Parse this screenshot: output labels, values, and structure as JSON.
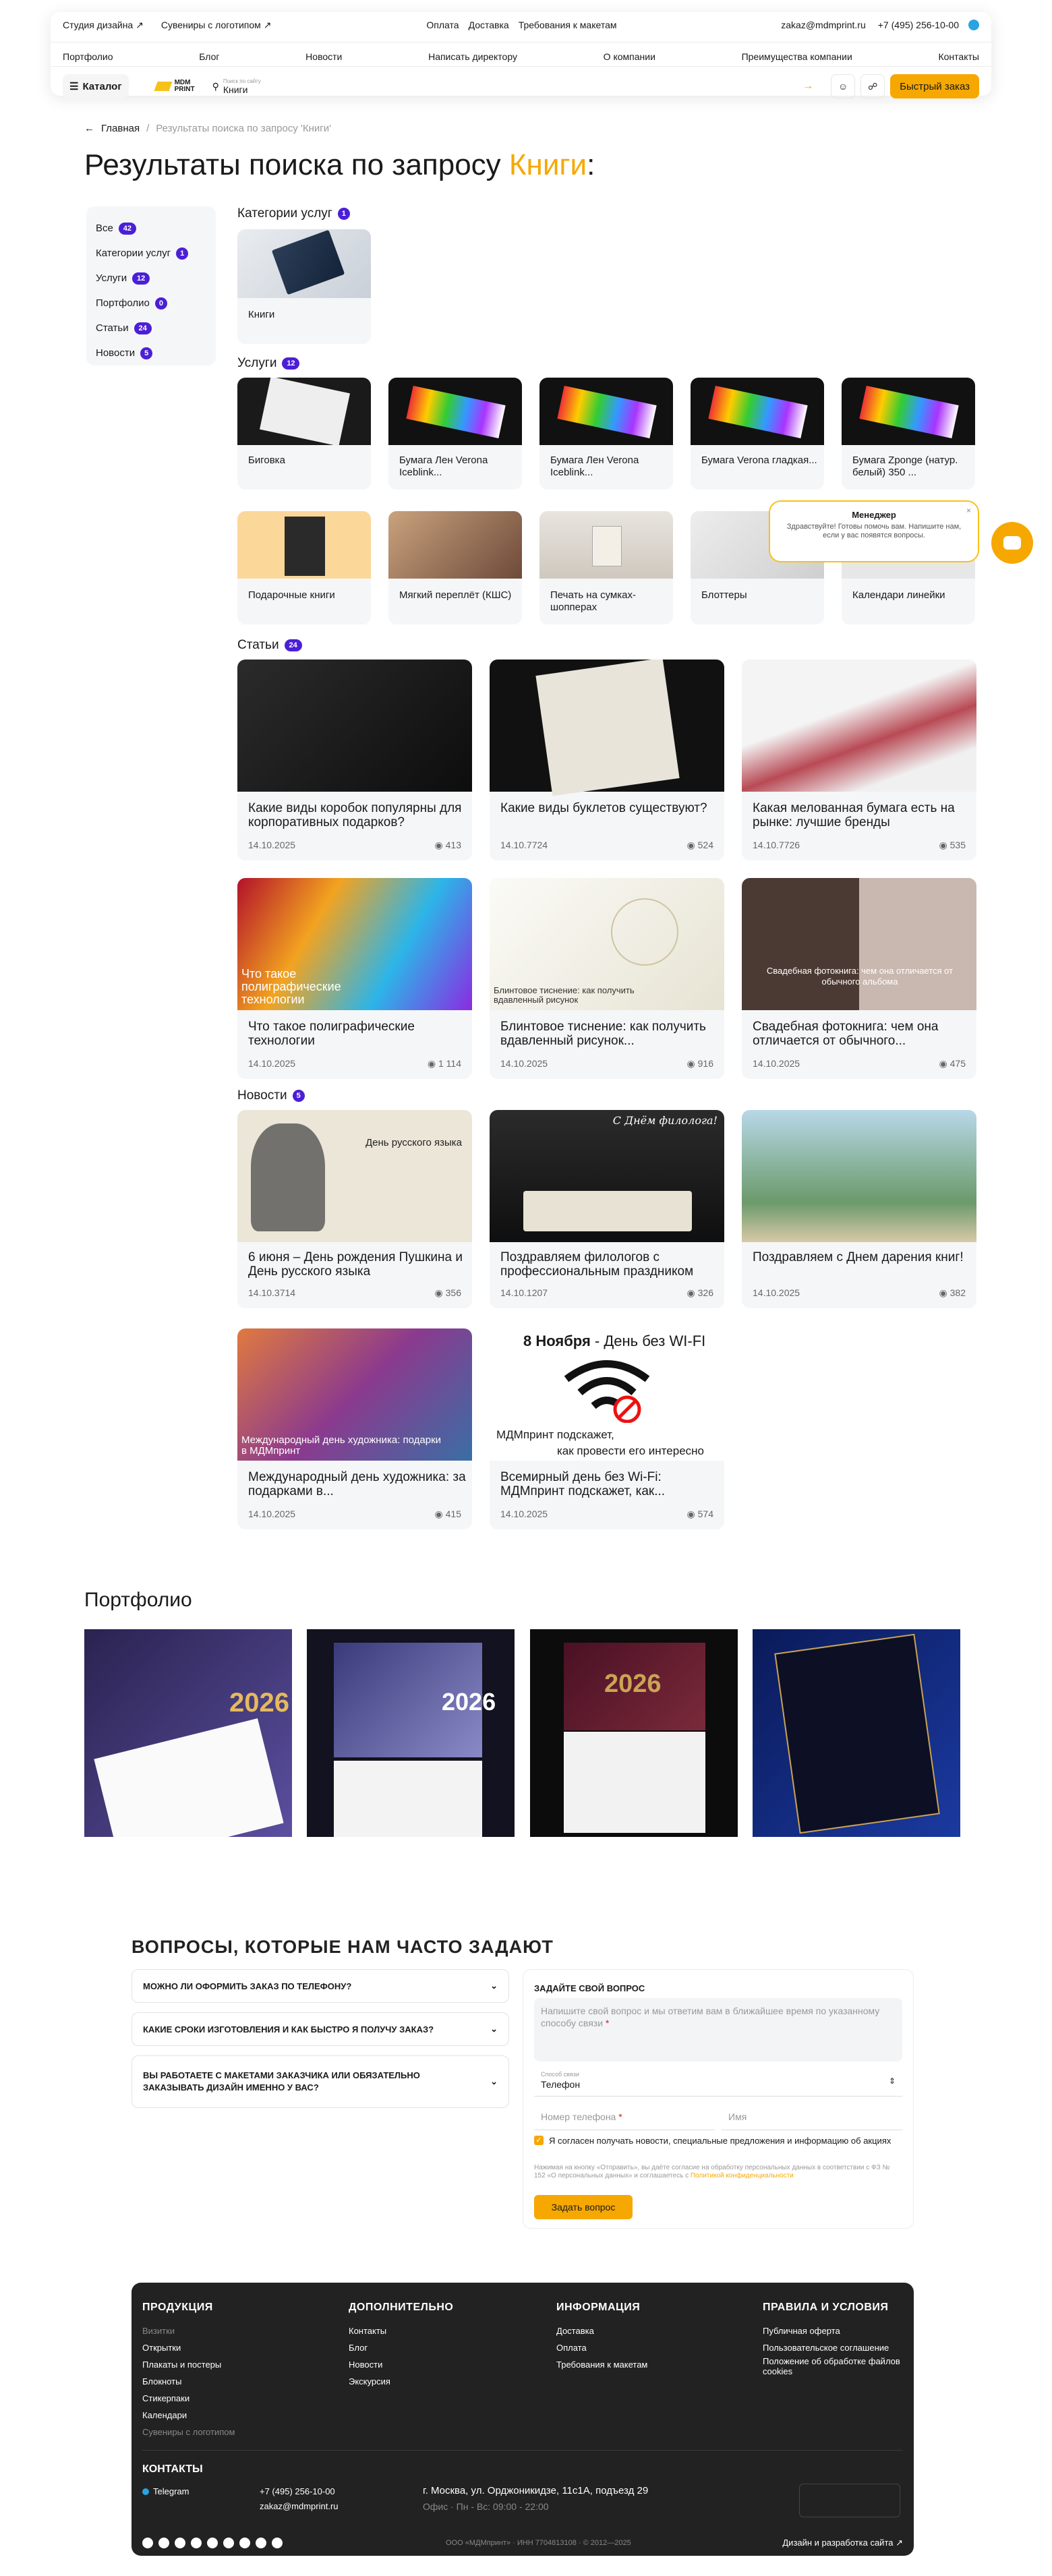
{
  "header": {
    "top_links": [
      "Студия дизайна ↗",
      "Сувениры с логотипом ↗",
      "Оплата",
      "Доставка",
      "Требования к макетам"
    ],
    "email": "zakaz@mdmprint.ru",
    "phone": "+7 (495) 256-10-00",
    "nav": [
      "Портфолио",
      "Блог",
      "Новости",
      "Написать директору",
      "О компании",
      "Преимущества компании",
      "Контакты"
    ],
    "catalog_label": "Каталог",
    "logo_text": "MDM PRINT",
    "search_hint": "Поиск по сайту",
    "search_value": "Книги",
    "quick_order": "Быстрый заказ"
  },
  "breadcrumb": {
    "home": "Главная",
    "current": "Результаты поиска по запросу 'Книги'"
  },
  "page_title": {
    "prefix": "Результаты поиска по запросу",
    "query": "Книги",
    "suffix": ":"
  },
  "filters": [
    {
      "label": "Все",
      "count": "42"
    },
    {
      "label": "Категории услуг",
      "count": "1"
    },
    {
      "label": "Услуги",
      "count": "12"
    },
    {
      "label": "Портфолио",
      "count": "0"
    },
    {
      "label": "Статьи",
      "count": "24"
    },
    {
      "label": "Новости",
      "count": "5"
    }
  ],
  "sections": {
    "categories": {
      "title": "Категории услуг",
      "count": "1",
      "items": [
        "Книги"
      ]
    },
    "services": {
      "title": "Услуги",
      "count": "12",
      "items": [
        "Биговка",
        "Бумага Лен Verona Iceblink...",
        "Бумага Лен Verona Iceblink...",
        "Бумага Verona гладкая...",
        "Бумага Zponge (натур. белый) 350 ...",
        "Подарочные книги",
        "Мягкий переплёт (КШС)",
        "Печать на сумках-шопперах",
        "Блоттеры",
        "Календари линейки"
      ]
    },
    "articles": {
      "title": "Статьи",
      "count": "24",
      "items": [
        {
          "title": "Какие виды коробок популярны для корпоративных подарков?",
          "date": "14.10.2025",
          "views": "413",
          "overlay": ""
        },
        {
          "title": "Какие виды буклетов существуют?",
          "date": "14.10.7724",
          "views": "524",
          "overlay": ""
        },
        {
          "title": "Какая мелованная бумага есть на рынке: лучшие бренды",
          "date": "14.10.7726",
          "views": "535",
          "overlay": ""
        },
        {
          "title": "Что такое полиграфические технологии",
          "date": "14.10.2025",
          "views": "1 114",
          "overlay": "Что такое полиграфические технологии"
        },
        {
          "title": "Блинтовое тиснение: как получить вдавленный рисунок...",
          "date": "14.10.2025",
          "views": "916",
          "overlay": "Блинтовое тиснение: как получить вдавленный рисунок"
        },
        {
          "title": "Свадебная фотокнига: чем она отличается от обычного...",
          "date": "14.10.2025",
          "views": "475",
          "overlay": "Свадебная фотокнига: чем она отличается от обычного альбома"
        }
      ]
    },
    "news": {
      "title": "Новости",
      "count": "5",
      "items": [
        {
          "title": "6 июня – День рождения Пушкина и День русского языка",
          "date": "14.10.3714",
          "views": "356",
          "overlay": "День русского языка"
        },
        {
          "title": "Поздравляем филологов с профессиональным праздником",
          "date": "14.10.1207",
          "views": "326",
          "overlay": "С Днём филолога!"
        },
        {
          "title": "Поздравляем с Днем дарения книг!",
          "date": "14.10.2025",
          "views": "382",
          "overlay": ""
        },
        {
          "title": "Международный день художника: за подарками в...",
          "date": "14.10.2025",
          "views": "415",
          "overlay": "Международный день художника: подарки в МДМпринт"
        },
        {
          "title": "Всемирный день без Wi-Fi: МДМпринт подскажет, как...",
          "date": "14.10.2025",
          "views": "574",
          "overlay": ""
        }
      ]
    }
  },
  "wifi_banner": {
    "date_bold": "8 Ноября",
    "date_rest": " - День без WI-FI",
    "line1": "МДМпринт подскажет,",
    "line2": "как провести его интересно"
  },
  "chat": {
    "title": "Менеджер",
    "text": "Здравствуйте! Готовы помочь вам. Напишите нам, если у вас появятся вопросы."
  },
  "portfolio": {
    "title": "Портфолио",
    "years": [
      "2026",
      "2026",
      "2026",
      ""
    ]
  },
  "faq": {
    "title": "ВОПРОСЫ, КОТОРЫЕ НАМ ЧАСТО ЗАДАЮТ",
    "items": [
      "МОЖНО ЛИ ОФОРМИТЬ ЗАКАЗ ПО ТЕЛЕФОНУ?",
      "КАКИЕ СРОКИ ИЗГОТОВЛЕНИЯ И КАК БЫСТРО Я ПОЛУЧУ ЗАКАЗ?",
      "ВЫ РАБОТАЕТЕ С МАКЕТАМИ ЗАКАЗЧИКА ИЛИ ОБЯЗАТЕЛЬНО ЗАКАЗЫВАТЬ ДИЗАЙН ИМЕННО У ВАС?"
    ]
  },
  "ask_form": {
    "title": "ЗАДАЙТЕ СВОЙ ВОПРОС",
    "question_placeholder": "Напишите свой вопрос и мы ответим вам в ближайшее время по указанному способу связи",
    "contact_label": "Способ связи",
    "contact_value": "Телефон",
    "phone_placeholder": "Номер телефона",
    "name_placeholder": "Имя",
    "consent": "Я согласен получать новости, специальные предложения и информацию об акциях",
    "legal": "Нажимая на кнопку «Отправить», вы даёте согласие на обработку персональных данных в соответствии с ФЗ № 152 «О персональных данных» и соглашаетесь с",
    "legal_link": "Политикой конфиденциальности",
    "submit": "Задать вопрос"
  },
  "footer": {
    "cols": [
      {
        "title": "ПРОДУКЦИЯ",
        "items": [
          "Визитки",
          "Открытки",
          "Плакаты и постеры",
          "Блокноты",
          "Стикерпаки",
          "Календари",
          "Сувениры с логотипом"
        ]
      },
      {
        "title": "ДОПОЛНИТЕЛЬНО",
        "items": [
          "Контакты",
          "Блог",
          "Новости",
          "Экскурсия"
        ]
      },
      {
        "title": "ИНФОРМАЦИЯ",
        "items": [
          "Доставка",
          "Оплата",
          "Требования к макетам"
        ]
      },
      {
        "title": "ПРАВИЛА И УСЛОВИЯ",
        "items": [
          "Публичная оферта",
          "Пользовательское соглашение",
          "Положение об обработке файлов cookies"
        ]
      }
    ],
    "contacts_title": "КОНТАКТЫ",
    "telegram": "Telegram",
    "phone": "+7 (495) 256-10-00",
    "email": "zakaz@mdmprint.ru",
    "address": "г. Москва, ул. Орджоникидзе, 11с1А, подъезд 29",
    "hours": "Офис · Пн - Вс: 09:00 - 22:00",
    "legal": "ООО «МДМпринт» · ИНН 7704813108 · © 2012—2025",
    "dev": "Дизайн и разработка сайта ↗"
  },
  "colors": {
    "accent": "#f6a800",
    "badge": "#4b1fd6",
    "footer_bg": "#222222"
  }
}
